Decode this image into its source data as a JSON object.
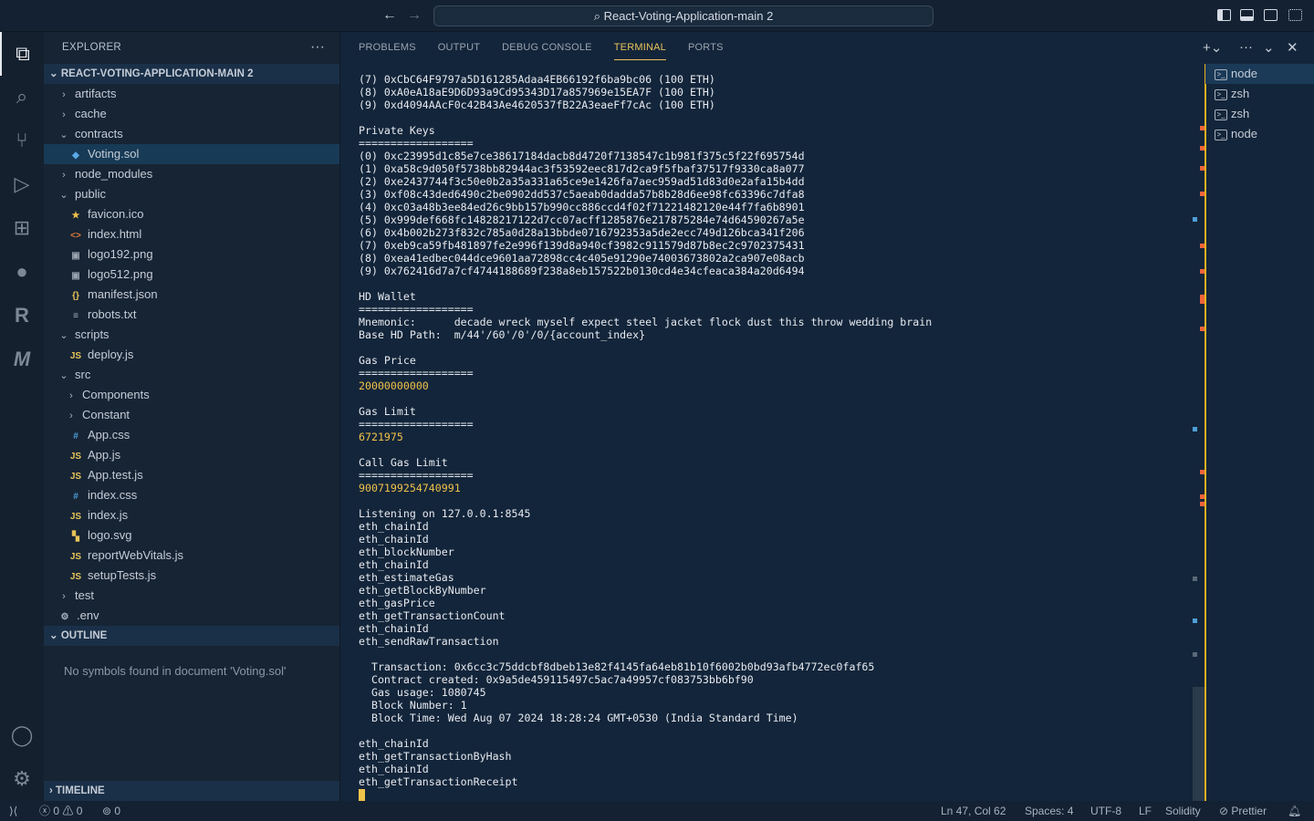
{
  "titlebar": {
    "search_title": "React-Voting-Application-main 2",
    "back_icon": "arrow-left-icon",
    "forward_icon": "arrow-right-icon"
  },
  "sidebar": {
    "header": "EXPLORER",
    "more": "···",
    "root": "REACT-VOTING-APPLICATION-MAIN 2",
    "tree": [
      {
        "label": "artifacts",
        "type": "folder",
        "open": false,
        "depth": 1
      },
      {
        "label": "cache",
        "type": "folder",
        "open": false,
        "depth": 1
      },
      {
        "label": "contracts",
        "type": "folder",
        "open": true,
        "depth": 1
      },
      {
        "label": "Voting.sol",
        "type": "sol",
        "depth": 2,
        "selected": true
      },
      {
        "label": "node_modules",
        "type": "folder",
        "open": false,
        "depth": 1
      },
      {
        "label": "public",
        "type": "folder",
        "open": true,
        "depth": 1
      },
      {
        "label": "favicon.ico",
        "type": "ico",
        "depth": 2
      },
      {
        "label": "index.html",
        "type": "html",
        "depth": 2
      },
      {
        "label": "logo192.png",
        "type": "img",
        "depth": 2
      },
      {
        "label": "logo512.png",
        "type": "img",
        "depth": 2
      },
      {
        "label": "manifest.json",
        "type": "json",
        "depth": 2
      },
      {
        "label": "robots.txt",
        "type": "txt",
        "depth": 2
      },
      {
        "label": "scripts",
        "type": "folder",
        "open": true,
        "depth": 1
      },
      {
        "label": "deploy.js",
        "type": "js",
        "depth": 2
      },
      {
        "label": "src",
        "type": "folder",
        "open": true,
        "depth": 1
      },
      {
        "label": "Components",
        "type": "folder",
        "open": false,
        "depth": 2
      },
      {
        "label": "Constant",
        "type": "folder",
        "open": false,
        "depth": 2
      },
      {
        "label": "App.css",
        "type": "css",
        "depth": 2
      },
      {
        "label": "App.js",
        "type": "js",
        "depth": 2
      },
      {
        "label": "App.test.js",
        "type": "js",
        "depth": 2
      },
      {
        "label": "index.css",
        "type": "css",
        "depth": 2
      },
      {
        "label": "index.js",
        "type": "js",
        "depth": 2
      },
      {
        "label": "logo.svg",
        "type": "svg",
        "depth": 2
      },
      {
        "label": "reportWebVitals.js",
        "type": "js",
        "depth": 2
      },
      {
        "label": "setupTests.js",
        "type": "js",
        "depth": 2
      },
      {
        "label": "test",
        "type": "folder",
        "open": false,
        "depth": 1
      },
      {
        "label": ".env",
        "type": "env",
        "depth": 1
      }
    ],
    "outline": "OUTLINE",
    "outline_msg": "No symbols found in document 'Voting.sol'",
    "timeline": "TIMELINE"
  },
  "activity": [
    "files-icon",
    "search-icon",
    "source-control-icon",
    "run-debug-icon",
    "extensions-icon",
    "github-icon",
    "r-icon",
    "mongodb-icon",
    "account-icon",
    "settings-gear-icon"
  ],
  "panel": {
    "tabs": [
      "PROBLEMS",
      "OUTPUT",
      "DEBUG CONSOLE",
      "TERMINAL",
      "PORTS"
    ],
    "active_tab": "TERMINAL",
    "terminals": [
      "node",
      "zsh",
      "zsh",
      "node"
    ]
  },
  "terminal": [
    {
      "t": "(7) 0xCbC64F9797a5D161285Adaa4EB66192f6ba9bc06 (100 ETH)"
    },
    {
      "t": "(8) 0xA0eA18aE9D6D93a9Cd95343D17a857969e15EA7F (100 ETH)"
    },
    {
      "t": "(9) 0xd4094AAcF0c42B43Ae4620537fB22A3eaeFf7cAc (100 ETH)"
    },
    {
      "t": ""
    },
    {
      "t": "Private Keys"
    },
    {
      "t": "=================="
    },
    {
      "t": "(0) 0xc23995d1c85e7ce38617184dacb8d4720f7138547c1b981f375c5f22f695754d"
    },
    {
      "t": "(1) 0xa58c9d050f5738bb82944ac3f53592eec817d2ca9f5fbaf37517f9330ca8a077"
    },
    {
      "t": "(2) 0xe2437744f3c50e0b2a35a331a65ce9e1426fa7aec959ad51d83d0e2afa15b4dd"
    },
    {
      "t": "(3) 0xf08c43ded6490c2be0902dd537c5aeab0dadda57b8b28d6ee98fc63396c7dfa8"
    },
    {
      "t": "(4) 0xc03a48b3ee84ed26c9bb157b990cc886ccd4f02f71221482120e44f7fa6b8901"
    },
    {
      "t": "(5) 0x999def668fc14828217122d7cc07acff1285876e217875284e74d64590267a5e"
    },
    {
      "t": "(6) 0x4b002b273f832c785a0d28a13bbde0716792353a5de2ecc749d126bca341f206"
    },
    {
      "t": "(7) 0xeb9ca59fb481897fe2e996f139d8a940cf3982c911579d87b8ec2c9702375431"
    },
    {
      "t": "(8) 0xea41edbec044dce9601aa72898cc4c405e91290e74003673802a2ca907e08acb"
    },
    {
      "t": "(9) 0x762416d7a7cf4744188689f238a8eb157522b0130cd4e34cfeaca384a20d6494"
    },
    {
      "t": ""
    },
    {
      "t": "HD Wallet"
    },
    {
      "t": "=================="
    },
    {
      "t": "Mnemonic:      decade wreck myself expect steel jacket flock dust this throw wedding brain"
    },
    {
      "t": "Base HD Path:  m/44'/60'/0'/0/{account_index}"
    },
    {
      "t": ""
    },
    {
      "t": "Gas Price"
    },
    {
      "t": "=================="
    },
    {
      "t": "20000000000",
      "c": "yel"
    },
    {
      "t": ""
    },
    {
      "t": "Gas Limit"
    },
    {
      "t": "=================="
    },
    {
      "t": "6721975",
      "c": "yel"
    },
    {
      "t": ""
    },
    {
      "t": "Call Gas Limit"
    },
    {
      "t": "=================="
    },
    {
      "t": "9007199254740991",
      "c": "yel"
    },
    {
      "t": ""
    },
    {
      "t": "Listening on 127.0.0.1:8545"
    },
    {
      "t": "eth_chainId"
    },
    {
      "t": "eth_chainId"
    },
    {
      "t": "eth_blockNumber"
    },
    {
      "t": "eth_chainId"
    },
    {
      "t": "eth_estimateGas"
    },
    {
      "t": "eth_getBlockByNumber"
    },
    {
      "t": "eth_gasPrice"
    },
    {
      "t": "eth_getTransactionCount"
    },
    {
      "t": "eth_chainId"
    },
    {
      "t": "eth_sendRawTransaction"
    },
    {
      "t": ""
    },
    {
      "t": "  Transaction: 0x6cc3c75ddcbf8dbeb13e82f4145fa64eb81b10f6002b0bd93afb4772ec0faf65"
    },
    {
      "t": "  Contract created: 0x9a5de459115497c5ac7a49957cf083753bb6bf90"
    },
    {
      "t": "  Gas usage: 1080745"
    },
    {
      "t": "  Block Number: 1"
    },
    {
      "t": "  Block Time: Wed Aug 07 2024 18:28:24 GMT+0530 (India Standard Time)"
    },
    {
      "t": ""
    },
    {
      "t": "eth_chainId"
    },
    {
      "t": "eth_getTransactionByHash"
    },
    {
      "t": "eth_chainId"
    },
    {
      "t": "eth_getTransactionReceipt"
    }
  ],
  "statusbar": {
    "errors": "0",
    "warnings": "0",
    "ports": "0",
    "position": "Ln 47, Col 62",
    "spaces": "Spaces: 4",
    "encoding": "UTF-8",
    "eol": "LF",
    "language": "Solidity",
    "formatter": "Prettier"
  },
  "colors": {
    "accent": "#e8c35a",
    "cursor": "#f0c34a",
    "marker": "#f0643a"
  }
}
